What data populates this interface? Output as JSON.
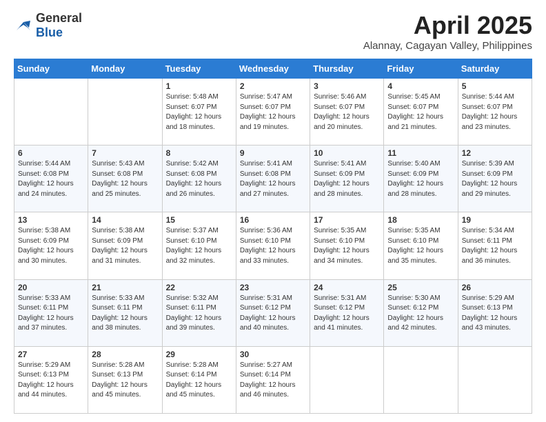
{
  "header": {
    "logo": {
      "general": "General",
      "blue": "Blue"
    },
    "title": "April 2025",
    "subtitle": "Alannay, Cagayan Valley, Philippines"
  },
  "calendar": {
    "days_of_week": [
      "Sunday",
      "Monday",
      "Tuesday",
      "Wednesday",
      "Thursday",
      "Friday",
      "Saturday"
    ],
    "weeks": [
      [
        {
          "day": "",
          "info": ""
        },
        {
          "day": "",
          "info": ""
        },
        {
          "day": "1",
          "info": "Sunrise: 5:48 AM\nSunset: 6:07 PM\nDaylight: 12 hours and 18 minutes."
        },
        {
          "day": "2",
          "info": "Sunrise: 5:47 AM\nSunset: 6:07 PM\nDaylight: 12 hours and 19 minutes."
        },
        {
          "day": "3",
          "info": "Sunrise: 5:46 AM\nSunset: 6:07 PM\nDaylight: 12 hours and 20 minutes."
        },
        {
          "day": "4",
          "info": "Sunrise: 5:45 AM\nSunset: 6:07 PM\nDaylight: 12 hours and 21 minutes."
        },
        {
          "day": "5",
          "info": "Sunrise: 5:44 AM\nSunset: 6:07 PM\nDaylight: 12 hours and 23 minutes."
        }
      ],
      [
        {
          "day": "6",
          "info": "Sunrise: 5:44 AM\nSunset: 6:08 PM\nDaylight: 12 hours and 24 minutes."
        },
        {
          "day": "7",
          "info": "Sunrise: 5:43 AM\nSunset: 6:08 PM\nDaylight: 12 hours and 25 minutes."
        },
        {
          "day": "8",
          "info": "Sunrise: 5:42 AM\nSunset: 6:08 PM\nDaylight: 12 hours and 26 minutes."
        },
        {
          "day": "9",
          "info": "Sunrise: 5:41 AM\nSunset: 6:08 PM\nDaylight: 12 hours and 27 minutes."
        },
        {
          "day": "10",
          "info": "Sunrise: 5:41 AM\nSunset: 6:09 PM\nDaylight: 12 hours and 28 minutes."
        },
        {
          "day": "11",
          "info": "Sunrise: 5:40 AM\nSunset: 6:09 PM\nDaylight: 12 hours and 28 minutes."
        },
        {
          "day": "12",
          "info": "Sunrise: 5:39 AM\nSunset: 6:09 PM\nDaylight: 12 hours and 29 minutes."
        }
      ],
      [
        {
          "day": "13",
          "info": "Sunrise: 5:38 AM\nSunset: 6:09 PM\nDaylight: 12 hours and 30 minutes."
        },
        {
          "day": "14",
          "info": "Sunrise: 5:38 AM\nSunset: 6:09 PM\nDaylight: 12 hours and 31 minutes."
        },
        {
          "day": "15",
          "info": "Sunrise: 5:37 AM\nSunset: 6:10 PM\nDaylight: 12 hours and 32 minutes."
        },
        {
          "day": "16",
          "info": "Sunrise: 5:36 AM\nSunset: 6:10 PM\nDaylight: 12 hours and 33 minutes."
        },
        {
          "day": "17",
          "info": "Sunrise: 5:35 AM\nSunset: 6:10 PM\nDaylight: 12 hours and 34 minutes."
        },
        {
          "day": "18",
          "info": "Sunrise: 5:35 AM\nSunset: 6:10 PM\nDaylight: 12 hours and 35 minutes."
        },
        {
          "day": "19",
          "info": "Sunrise: 5:34 AM\nSunset: 6:11 PM\nDaylight: 12 hours and 36 minutes."
        }
      ],
      [
        {
          "day": "20",
          "info": "Sunrise: 5:33 AM\nSunset: 6:11 PM\nDaylight: 12 hours and 37 minutes."
        },
        {
          "day": "21",
          "info": "Sunrise: 5:33 AM\nSunset: 6:11 PM\nDaylight: 12 hours and 38 minutes."
        },
        {
          "day": "22",
          "info": "Sunrise: 5:32 AM\nSunset: 6:11 PM\nDaylight: 12 hours and 39 minutes."
        },
        {
          "day": "23",
          "info": "Sunrise: 5:31 AM\nSunset: 6:12 PM\nDaylight: 12 hours and 40 minutes."
        },
        {
          "day": "24",
          "info": "Sunrise: 5:31 AM\nSunset: 6:12 PM\nDaylight: 12 hours and 41 minutes."
        },
        {
          "day": "25",
          "info": "Sunrise: 5:30 AM\nSunset: 6:12 PM\nDaylight: 12 hours and 42 minutes."
        },
        {
          "day": "26",
          "info": "Sunrise: 5:29 AM\nSunset: 6:13 PM\nDaylight: 12 hours and 43 minutes."
        }
      ],
      [
        {
          "day": "27",
          "info": "Sunrise: 5:29 AM\nSunset: 6:13 PM\nDaylight: 12 hours and 44 minutes."
        },
        {
          "day": "28",
          "info": "Sunrise: 5:28 AM\nSunset: 6:13 PM\nDaylight: 12 hours and 45 minutes."
        },
        {
          "day": "29",
          "info": "Sunrise: 5:28 AM\nSunset: 6:14 PM\nDaylight: 12 hours and 45 minutes."
        },
        {
          "day": "30",
          "info": "Sunrise: 5:27 AM\nSunset: 6:14 PM\nDaylight: 12 hours and 46 minutes."
        },
        {
          "day": "",
          "info": ""
        },
        {
          "day": "",
          "info": ""
        },
        {
          "day": "",
          "info": ""
        }
      ]
    ]
  }
}
